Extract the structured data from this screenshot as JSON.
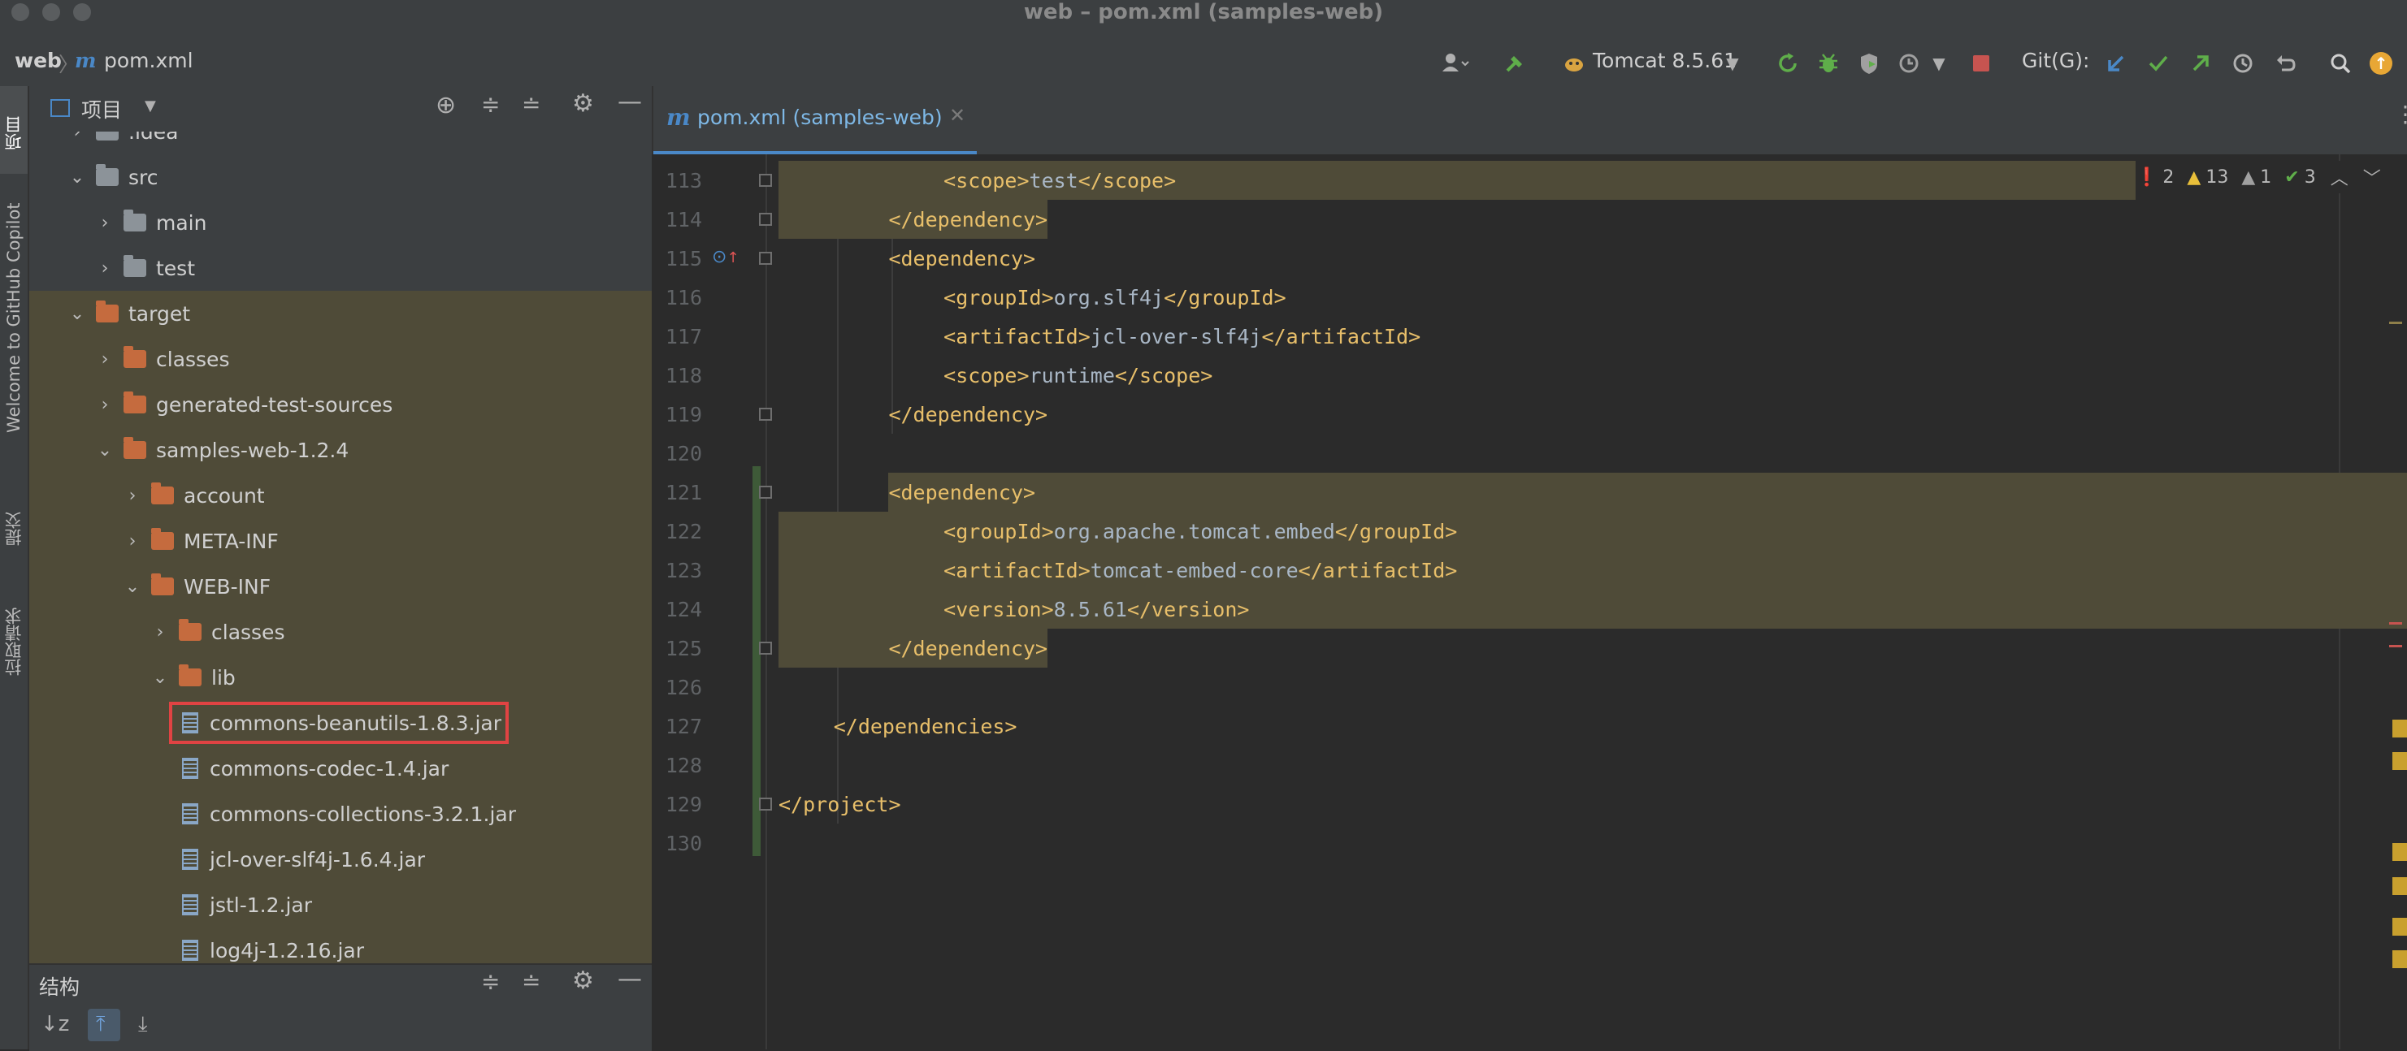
{
  "window": {
    "title": "web – pom.xml (samples-web)"
  },
  "breadcrumb": {
    "project": "web",
    "file": "pom.xml"
  },
  "toolbar": {
    "run_config": "Tomcat 8.5.61",
    "git_label": "Git(G):"
  },
  "left_strip": {
    "tabs": [
      "项目",
      "Welcome to GitHub Copilot",
      "提交",
      "拉取请求"
    ]
  },
  "project_panel": {
    "title": "项目",
    "tree": [
      {
        "label": ".idea",
        "indent": 1,
        "kind": "folder-gray",
        "expanded": false
      },
      {
        "label": "src",
        "indent": 1,
        "kind": "folder-gray",
        "expanded": true
      },
      {
        "label": "main",
        "indent": 2,
        "kind": "folder-gray",
        "expanded": false
      },
      {
        "label": "test",
        "indent": 2,
        "kind": "folder-gray",
        "expanded": false
      },
      {
        "label": "target",
        "indent": 1,
        "kind": "folder-orange",
        "expanded": true
      },
      {
        "label": "classes",
        "indent": 2,
        "kind": "folder-orange",
        "expanded": false
      },
      {
        "label": "generated-test-sources",
        "indent": 2,
        "kind": "folder-orange",
        "expanded": false
      },
      {
        "label": "samples-web-1.2.4",
        "indent": 2,
        "kind": "folder-orange",
        "expanded": true
      },
      {
        "label": "account",
        "indent": 3,
        "kind": "folder-orange",
        "expanded": false
      },
      {
        "label": "META-INF",
        "indent": 3,
        "kind": "folder-orange",
        "expanded": false
      },
      {
        "label": "WEB-INF",
        "indent": 3,
        "kind": "folder-orange",
        "expanded": true
      },
      {
        "label": "classes",
        "indent": 4,
        "kind": "folder-orange",
        "expanded": false
      },
      {
        "label": "lib",
        "indent": 4,
        "kind": "folder-orange",
        "expanded": true
      },
      {
        "label": "commons-beanutils-1.8.3.jar",
        "indent": 5,
        "kind": "jar",
        "selected": true
      },
      {
        "label": "commons-codec-1.4.jar",
        "indent": 5,
        "kind": "jar"
      },
      {
        "label": "commons-collections-3.2.1.jar",
        "indent": 5,
        "kind": "jar"
      },
      {
        "label": "jcl-over-slf4j-1.6.4.jar",
        "indent": 5,
        "kind": "jar"
      },
      {
        "label": "jstl-1.2.jar",
        "indent": 5,
        "kind": "jar"
      },
      {
        "label": "log4j-1.2.16.jar",
        "indent": 5,
        "kind": "jar"
      }
    ]
  },
  "structure_panel": {
    "title": "结构"
  },
  "editor": {
    "tab_label": "pom.xml (samples-web)",
    "inspections": {
      "errors": "2",
      "warnings": "13",
      "weak_warnings": "1",
      "ok": "3"
    },
    "lines": [
      {
        "num": "113",
        "indent": 3,
        "tokens": [
          [
            "tag",
            "<scope>"
          ],
          [
            "txt",
            "test"
          ],
          [
            "tag",
            "</scope>"
          ]
        ],
        "hl": "full"
      },
      {
        "num": "114",
        "indent": 2,
        "tokens": [
          [
            "tag",
            "</dependency>"
          ]
        ],
        "hl": "partial"
      },
      {
        "num": "115",
        "indent": 2,
        "tokens": [
          [
            "tag",
            "<dependency>"
          ]
        ]
      },
      {
        "num": "116",
        "indent": 3,
        "tokens": [
          [
            "tag",
            "<groupId>"
          ],
          [
            "txt",
            "org.slf4j"
          ],
          [
            "tag",
            "</groupId>"
          ]
        ]
      },
      {
        "num": "117",
        "indent": 3,
        "tokens": [
          [
            "tag",
            "<artifactId>"
          ],
          [
            "txt",
            "jcl-over-slf4j"
          ],
          [
            "tag",
            "</artifactId>"
          ]
        ]
      },
      {
        "num": "118",
        "indent": 3,
        "tokens": [
          [
            "tag",
            "<scope>"
          ],
          [
            "txt",
            "runtime"
          ],
          [
            "tag",
            "</scope>"
          ]
        ]
      },
      {
        "num": "119",
        "indent": 2,
        "tokens": [
          [
            "tag",
            "</dependency>"
          ]
        ]
      },
      {
        "num": "120",
        "indent": 0,
        "tokens": []
      },
      {
        "num": "121",
        "indent": 2,
        "tokens": [
          [
            "tag",
            "<dependency>"
          ]
        ],
        "hl": "full-from-code"
      },
      {
        "num": "122",
        "indent": 3,
        "tokens": [
          [
            "tag",
            "<groupId>"
          ],
          [
            "txt",
            "org.apache.tomcat.embed"
          ],
          [
            "tag",
            "</groupId>"
          ]
        ],
        "hl": "full"
      },
      {
        "num": "123",
        "indent": 3,
        "tokens": [
          [
            "tag",
            "<artifactId>"
          ],
          [
            "txt",
            "tomcat-embed-core"
          ],
          [
            "tag",
            "</artifactId>"
          ]
        ],
        "hl": "full"
      },
      {
        "num": "124",
        "indent": 3,
        "tokens": [
          [
            "tag",
            "<version>"
          ],
          [
            "txt",
            "8.5.61"
          ],
          [
            "tag",
            "</version>"
          ]
        ],
        "hl": "full"
      },
      {
        "num": "125",
        "indent": 2,
        "tokens": [
          [
            "tag",
            "</dependency>"
          ]
        ],
        "hl": "partial"
      },
      {
        "num": "126",
        "indent": 0,
        "tokens": []
      },
      {
        "num": "127",
        "indent": 1,
        "tokens": [
          [
            "tag",
            "</dependencies>"
          ]
        ]
      },
      {
        "num": "128",
        "indent": 0,
        "tokens": []
      },
      {
        "num": "129",
        "indent": 0,
        "tokens": [
          [
            "tag",
            "</project>"
          ]
        ]
      },
      {
        "num": "130",
        "indent": 0,
        "tokens": []
      }
    ]
  },
  "colors": {
    "accent": "#4a88c7",
    "selection_box": "#e04343",
    "folder_orange": "#c56b3e",
    "folder_gray": "#8c9399",
    "highlight": "#4f4b38"
  }
}
